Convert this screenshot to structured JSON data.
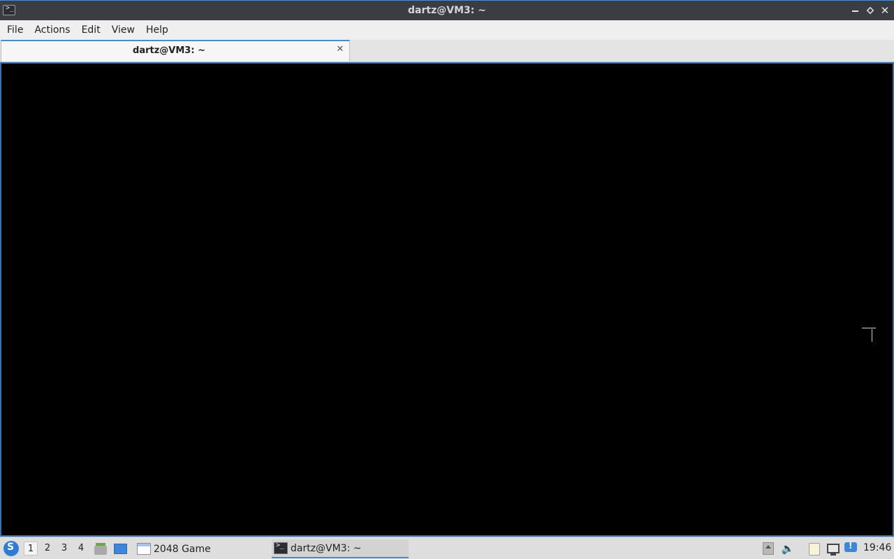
{
  "window": {
    "title": "dartz@VM3: ~",
    "app_icon": "terminal-icon",
    "app_icon_glyph": ">_",
    "controls": {
      "minimize": "minimize-icon",
      "maximize": "maximize-icon",
      "close": "close-icon",
      "close_glyph": "✕"
    }
  },
  "menubar": {
    "items": [
      "File",
      "Actions",
      "Edit",
      "View",
      "Help"
    ]
  },
  "tabs": [
    {
      "label": "dartz@VM3: ~",
      "active": true,
      "close_glyph": "✕"
    }
  ],
  "terminal": {
    "background": "#000000",
    "content": ""
  },
  "taskbar": {
    "start_icon": "lxqt-start-icon",
    "start_glyph": "S",
    "desktops": [
      "1",
      "2",
      "3",
      "4"
    ],
    "active_desktop": "1",
    "quicklaunch": [
      "file-manager-icon",
      "show-desktop-icon"
    ],
    "tasks": [
      {
        "label": "2048 Game",
        "icon": "window-icon",
        "active": false
      },
      {
        "label": "dartz@VM3: ~",
        "icon": "terminal-icon",
        "glyph": ">_",
        "active": true
      }
    ],
    "tray": [
      "eject-icon",
      "volume-icon",
      "clipboard-icon",
      "network-icon",
      "notification-icon"
    ],
    "notification_glyph": "!",
    "volume_glyph": "🔈",
    "clock": "19:46"
  },
  "colors": {
    "accent": "#3f8ed9",
    "titlebar": "#3a3d42",
    "menubar": "#efefef",
    "taskbar": "#dedede"
  }
}
